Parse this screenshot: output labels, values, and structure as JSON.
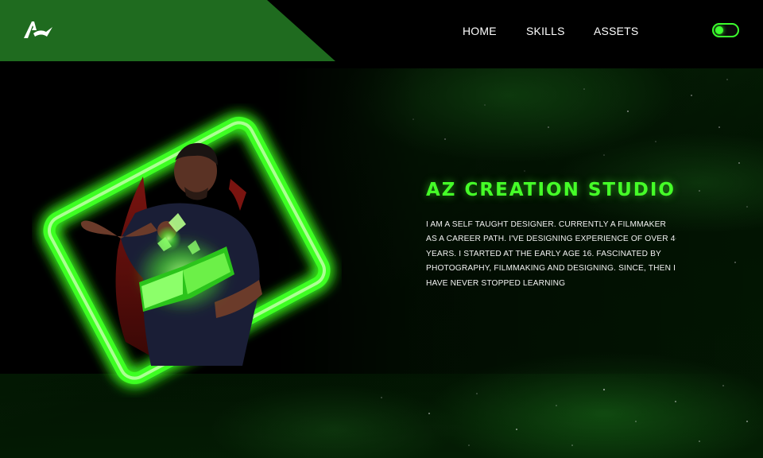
{
  "nav": {
    "home": "HOME",
    "skills": "SKILLS",
    "assets": "ASSETS"
  },
  "theme_toggle": {
    "state": "on"
  },
  "hero": {
    "title": "AZ CREATION STUDIO",
    "description_lines": [
      "I AM A SELF TAUGHT DESIGNER. CURRENTLY A FILMMAKER",
      "AS A CAREER PATH. I'VE DESIGNING EXPERIENCE OF OVER 4",
      "YEARS. I STARTED AT THE EARLY AGE 16. FASCINATED BY",
      "PHOTOGRAPHY, FILMMAKING AND DESIGNING. SINCE, THEN I",
      "HAVE NEVER STOPPED LEARNING"
    ]
  },
  "colors": {
    "accent": "#45ff28",
    "brand_panel": "#1f6b1f",
    "header": "#000000",
    "background": "#041f04"
  },
  "icons": {
    "logo": "az-logo-icon",
    "toggle": "theme-toggle-icon"
  }
}
